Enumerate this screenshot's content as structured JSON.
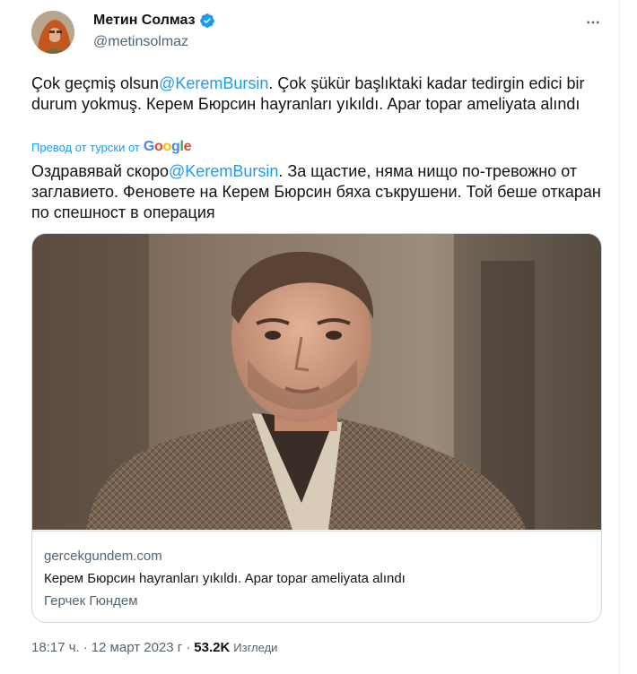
{
  "author": {
    "name": "Метин Солмаз",
    "handle": "@metinsolmaz",
    "verified_color": "#1d9bf0"
  },
  "tweet": {
    "original": {
      "before": "Çok geçmiş olsun",
      "mention": "@KeremBursin",
      "after": ". Çok şükür başlıktaki kadar tedirgin edici bir durum yokmuş. Керем Бюрсин hayranları yıkıldı. Apar topar ameliyata alındı"
    },
    "translated_from_label": "Превод от турски от",
    "google_label": "Google",
    "translation": {
      "before": "Оздравявай скоро",
      "mention": "@KeremBursin",
      "after": ". За щастие, няма нищо по-тревожно от заглавието. Феновете на Керем Бюрсин бяха съкрушени. Той беше откаран по спешност в операция"
    }
  },
  "card": {
    "domain": "gercekgundem.com",
    "title": "Керем Бюрсин hayranları yıkıldı. Apar topar ameliyata alındı",
    "source": "Герчек Гюндем"
  },
  "footer": {
    "time": "18:17 ч.",
    "separator": "·",
    "date": "12 март 2023 г",
    "views_count": "53.2K",
    "views_label": "Изгледи"
  },
  "colors": {
    "accent": "#1d9bf0",
    "secondary_text": "#536471",
    "border": "#cfd9de"
  }
}
